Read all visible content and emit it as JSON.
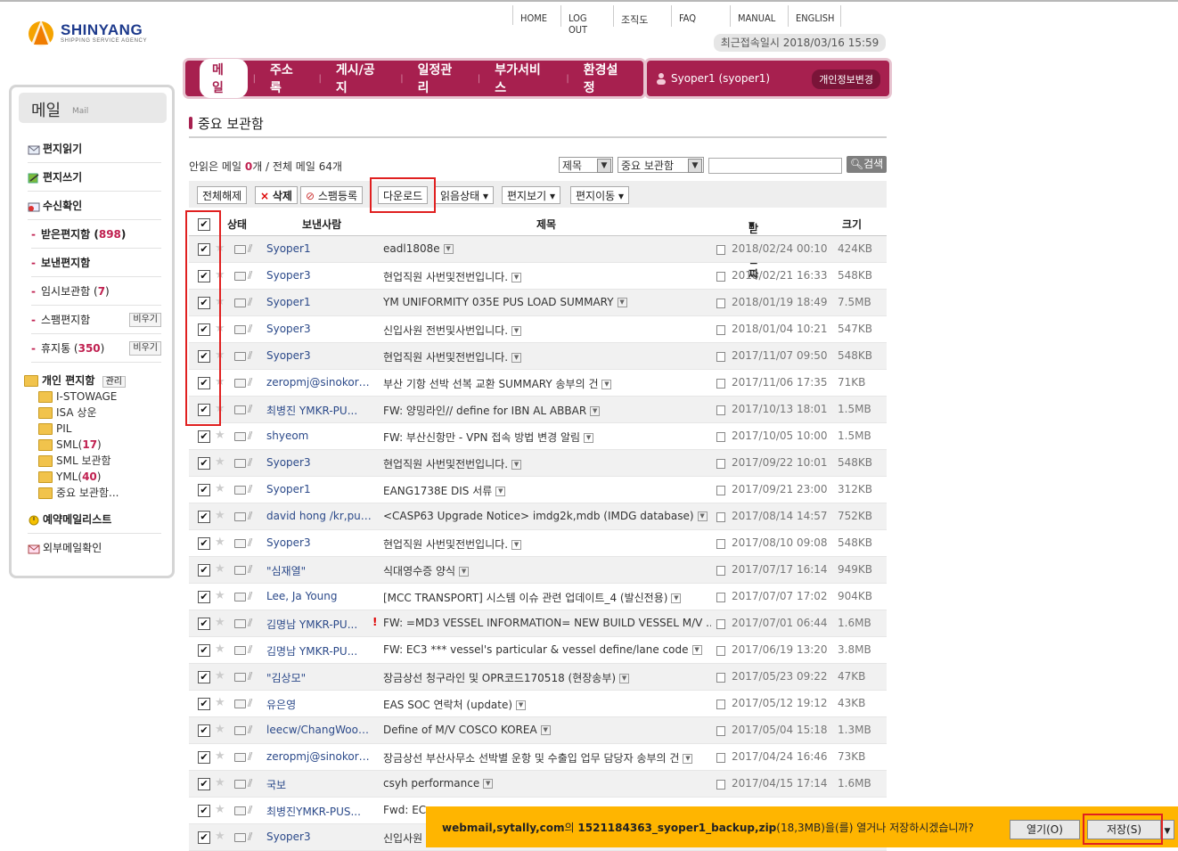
{
  "brand": {
    "name": "SHINYANG",
    "tagline": "SHIPPING SERVICE AGENCY"
  },
  "toplinks": [
    "HOME",
    "LOG OUT",
    "조직도",
    "FAQ",
    "MANUAL",
    "ENGLISH"
  ],
  "last_login": "최근접속일시 2018/03/16 15:59",
  "nav": [
    "메일",
    "주소록",
    "게시/공지",
    "일정관리",
    "부가서비스",
    "환경설정"
  ],
  "user": {
    "name": "Syoper1 (syoper1)",
    "edit_label": "개인정보변경"
  },
  "sidebar": {
    "title": "메일",
    "title_en": "Mail",
    "read": "편지읽기",
    "write": "편지쓰기",
    "receipt": "수신확인",
    "inbox": "받은편지함",
    "inbox_count": "898",
    "sent": "보낸편지함",
    "drafts": "임시보관함",
    "drafts_count": "7",
    "spam": "스팸편지함",
    "spam_empty": "비우기",
    "trash": "휴지통",
    "trash_count": "350",
    "trash_empty": "비우기",
    "personal": "개인 편지함",
    "manage": "관리",
    "folders": [
      {
        "name": "I-STOWAGE",
        "count": ""
      },
      {
        "name": "ISA 상운",
        "count": ""
      },
      {
        "name": "PIL",
        "count": ""
      },
      {
        "name": "SML",
        "count": "17"
      },
      {
        "name": "SML 보관함",
        "count": ""
      },
      {
        "name": "YML",
        "count": "40"
      },
      {
        "name": "중요 보관함...",
        "count": ""
      }
    ],
    "reserve": "예약메일리스트",
    "external": "외부메일확인"
  },
  "content": {
    "title": "중요 보관함",
    "unread_prefix": "안읽은 메일 ",
    "unread_count": "0",
    "unread_suffix": "개 / 전체 메일 64개",
    "search_field": "제목",
    "search_scope": "중요 보관함",
    "search_button": "검색"
  },
  "toolbar": [
    "전체해제",
    "삭제",
    "스팸등록",
    "다운로드",
    "읽음상태",
    "편지보기",
    "편지이동"
  ],
  "columns": {
    "status": "상태",
    "sender": "보낸사람",
    "subject": "제목",
    "date": "받은날짜",
    "size": "크기"
  },
  "rows": [
    {
      "sender": "Syoper1",
      "subject": "eadl1808e",
      "date": "2018/02/24 00:10",
      "size": "424KB",
      "imp": ""
    },
    {
      "sender": "Syoper3",
      "subject": "현업직원 사번및전번입니다.",
      "date": "2018/02/21 16:33",
      "size": "548KB",
      "imp": ""
    },
    {
      "sender": "Syoper1",
      "subject": "YM UNIFORMITY 035E PUS LOAD SUMMARY",
      "date": "2018/01/19 18:49",
      "size": "7.5MB",
      "imp": ""
    },
    {
      "sender": "Syoper3",
      "subject": "신입사원 전번및사번입니다.",
      "date": "2018/01/04 10:21",
      "size": "547KB",
      "imp": ""
    },
    {
      "sender": "Syoper3",
      "subject": "현업직원 사번및전번입니다.",
      "date": "2017/11/07 09:50",
      "size": "548KB",
      "imp": ""
    },
    {
      "sender": "zeropmj@sinokor,...",
      "subject": "부산 기항 선박 선복 교환 SUMMARY 송부의 건",
      "date": "2017/11/06 17:35",
      "size": "71KB",
      "imp": ""
    },
    {
      "sender": "최병진 YMKR-PU...",
      "subject": "FW: 양밍라인// define for IBN AL ABBAR",
      "date": "2017/10/13 18:01",
      "size": "1.5MB",
      "imp": ""
    },
    {
      "sender": "shyeom",
      "subject": "FW: 부산신항만 - VPN 접속 방법 변경 알림",
      "date": "2017/10/05 10:00",
      "size": "1.5MB",
      "imp": ""
    },
    {
      "sender": "Syoper3",
      "subject": "현업직원 사번및전번입니다.",
      "date": "2017/09/22 10:01",
      "size": "548KB",
      "imp": ""
    },
    {
      "sender": "Syoper1",
      "subject": "EANG1738E DIS 서류",
      "date": "2017/09/21 23:00",
      "size": "312KB",
      "imp": ""
    },
    {
      "sender": "david hong /kr,pu,...",
      "subject": "<CASP63 Upgrade Notice> imdg2k,mdb (IMDG database)",
      "date": "2017/08/14 14:57",
      "size": "752KB",
      "imp": ""
    },
    {
      "sender": "Syoper3",
      "subject": "현업직원 사번및전번입니다.",
      "date": "2017/08/10 09:08",
      "size": "548KB",
      "imp": ""
    },
    {
      "sender": "\"심재열\"",
      "subject": "식대영수증 양식",
      "date": "2017/07/17 16:14",
      "size": "949KB",
      "imp": ""
    },
    {
      "sender": "Lee, Ja Young",
      "subject": "[MCC TRANSPORT] 시스템 이슈 관련 업데이트_4 (발신전용)",
      "date": "2017/07/07 17:02",
      "size": "904KB",
      "imp": ""
    },
    {
      "sender": "김명남 YMKR-PU...",
      "subject": "FW: =MD3 VESSEL INFORMATION= NEW BUILD VESSEL M/V ...",
      "date": "2017/07/01 06:44",
      "size": "1.6MB",
      "imp": "!"
    },
    {
      "sender": "김명남 YMKR-PU...",
      "subject": "FW: EC3 *** vessel's particular & vessel define/lane code",
      "date": "2017/06/19 13:20",
      "size": "3.8MB",
      "imp": ""
    },
    {
      "sender": "\"김상모\"",
      "subject": "장금상선 청구라인 및 OPR코드170518 (현장송부)",
      "date": "2017/05/23 09:22",
      "size": "47KB",
      "imp": ""
    },
    {
      "sender": "유은영",
      "subject": "EAS SOC 연락처 (update)",
      "date": "2017/05/12 19:12",
      "size": "43KB",
      "imp": ""
    },
    {
      "sender": "leecw/ChangWoo,...",
      "subject": "Define of M/V COSCO KOREA",
      "date": "2017/05/04 15:18",
      "size": "1.3MB",
      "imp": ""
    },
    {
      "sender": "zeropmj@sinokor,...",
      "subject": "장금상선 부산사무소 선박별 운항 및 수출입 업무 담당자 송부의 건",
      "date": "2017/04/24 16:46",
      "size": "73KB",
      "imp": ""
    },
    {
      "sender": "국보",
      "subject": "csyh performance",
      "date": "2017/04/15 17:14",
      "size": "1.6MB",
      "imp": ""
    },
    {
      "sender": "최병진YMKR-PUS...",
      "subject": "Fwd: EC",
      "date": "",
      "size": "",
      "imp": ""
    },
    {
      "sender": "Syoper3",
      "subject": "신입사원",
      "date": "",
      "size": "",
      "imp": ""
    }
  ],
  "download": {
    "msg_site": "webmail,sytally,com",
    "msg_mid": "의 ",
    "msg_file": "1521184363_syoper1_backup,zip",
    "msg_rest": "(18,3MB)을(를) 열거나 저장하시겠습니까?",
    "open": "열기(O)",
    "save": "저장(S)"
  }
}
